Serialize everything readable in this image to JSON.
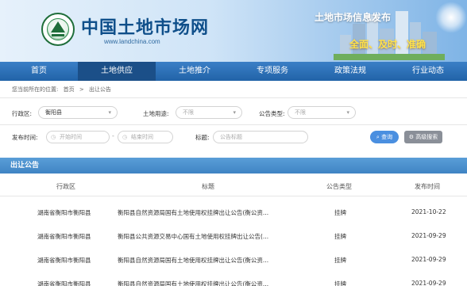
{
  "header": {
    "title": "中国土地市场网",
    "url": "www.landchina.com",
    "slogan_title": "土地市场信息发布",
    "slogan_tags": "全面、及时、准确"
  },
  "nav": {
    "items": [
      {
        "label": "首页"
      },
      {
        "label": "土地供应"
      },
      {
        "label": "土地推介"
      },
      {
        "label": "专项服务"
      },
      {
        "label": "政策法规"
      },
      {
        "label": "行业动态"
      }
    ],
    "active_index": 1
  },
  "breadcrumb": {
    "prefix": "您当前所在的位置:",
    "home": "首页",
    "separator": ">",
    "current": "出让公告"
  },
  "filters": {
    "region_label": "行政区:",
    "region_value": "衡阳县",
    "land_use_label": "土地用途:",
    "land_use_value": "不限",
    "notice_type_label": "公告类型:",
    "notice_type_value": "不限",
    "publish_time_label": "发布时间:",
    "start_placeholder": "开始时间",
    "end_placeholder": "结束时间",
    "dash": "-",
    "title_label": "标题:",
    "title_placeholder": "公告标题",
    "search_button": "查询",
    "advanced_button": "高级搜索"
  },
  "section": {
    "title": "出让公告"
  },
  "table": {
    "headers": [
      "行政区",
      "标题",
      "公告类型",
      "发布时间"
    ],
    "rows": [
      {
        "region": "湖南省衡阳市衡阳县",
        "title": "衡阳县自然资源局国有土地使用权挂牌出让公告(衡公资...",
        "type": "挂牌",
        "date": "2021-10-22"
      },
      {
        "region": "湖南省衡阳市衡阳县",
        "title": "衡阳县公共资源交易中心国有土地使用权挂牌出让公告(...",
        "type": "挂牌",
        "date": "2021-09-29"
      },
      {
        "region": "湖南省衡阳市衡阳县",
        "title": "衡阳县自然资源局国有土地使用权挂牌出让公告(衡公资...",
        "type": "挂牌",
        "date": "2021-09-29"
      },
      {
        "region": "湖南省衡阳市衡阳县",
        "title": "衡阳县自然资源局国有土地使用权挂牌出让公告(衡公资...",
        "type": "挂牌",
        "date": "2021-09-29"
      }
    ]
  },
  "colors": {
    "nav_bg": "#2163a8",
    "nav_active": "#1b4f88",
    "section_bar": "#3f84c4",
    "search_button": "#4a8fe0",
    "slogan_tags": "#ffe24a"
  }
}
